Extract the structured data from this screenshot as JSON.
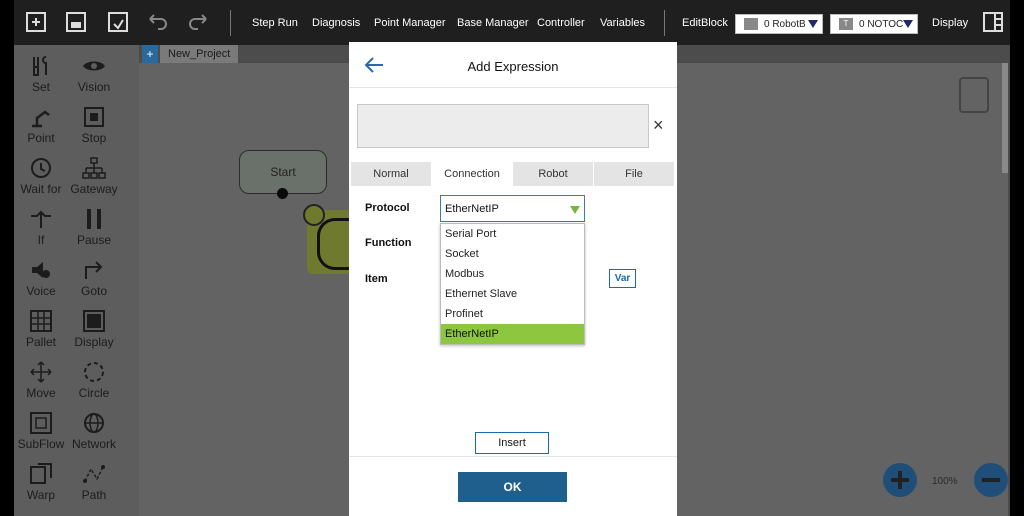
{
  "toolbar": {
    "menu": [
      "Step Run",
      "Diagnosis",
      "Point Manager",
      "Base Manager",
      "Controller",
      "Variables",
      "EditBlock"
    ],
    "robot_select": {
      "badge": "",
      "value": "0 RobotB"
    },
    "tool_select": {
      "badge": "T",
      "value": "0 NOTOC"
    },
    "display_label": "Display"
  },
  "palette": {
    "items": [
      "Set",
      "Vision",
      "Point",
      "Stop",
      "Wait for",
      "Gateway",
      "If",
      "Pause",
      "Voice",
      "Goto",
      "Pallet",
      "Display",
      "Move",
      "Circle",
      "SubFlow",
      "Network",
      "Warp",
      "Path"
    ]
  },
  "canvas": {
    "project_add": "+",
    "project_name": "New_Project",
    "start_label": "Start",
    "zoom_level": "100%"
  },
  "dialog": {
    "title": "Add Expression",
    "expression_value": "",
    "clear_glyph": "×",
    "tabs": [
      "Normal",
      "Connection",
      "Robot",
      "File"
    ],
    "active_tab": "Connection",
    "protocol_label": "Protocol",
    "function_label": "Function",
    "item_label": "Item",
    "protocol_value": "EtherNetIP",
    "protocol_options": [
      "Serial Port",
      "Socket",
      "Modbus",
      "Ethernet Slave",
      "Profinet",
      "EtherNetIP"
    ],
    "var_label": "Var",
    "insert_label": "Insert",
    "ok_label": "OK"
  },
  "colors": {
    "accent_blue": "#1f5f8e",
    "selected_green": "#8dc63f",
    "toolbar_bg": "#1f1f1f"
  }
}
